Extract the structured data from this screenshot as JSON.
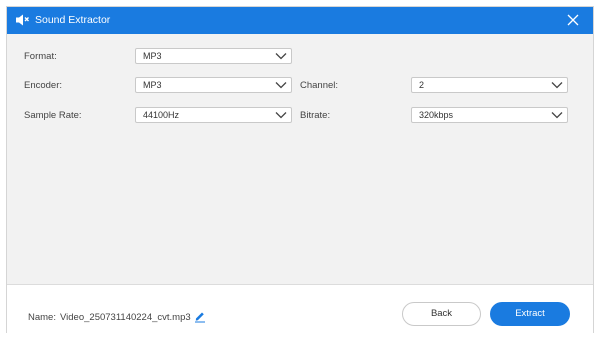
{
  "window": {
    "title": "Sound Extractor",
    "accent": "#1a7be0"
  },
  "fields": {
    "format": {
      "label": "Format:",
      "value": "MP3"
    },
    "encoder": {
      "label": "Encoder:",
      "value": "MP3"
    },
    "channel": {
      "label": "Channel:",
      "value": "2"
    },
    "sample_rate": {
      "label": "Sample Rate:",
      "value": "44100Hz"
    },
    "bitrate": {
      "label": "Bitrate:",
      "value": "320kbps"
    }
  },
  "footer": {
    "name_label": "Name:",
    "name_value": "Video_250731140224_cvt.mp3",
    "back_label": "Back",
    "extract_label": "Extract"
  },
  "icons": {
    "title": "sound-extractor-icon",
    "close": "close-icon",
    "dropdown": "chevron-down-icon",
    "edit": "pencil-edit-icon"
  }
}
